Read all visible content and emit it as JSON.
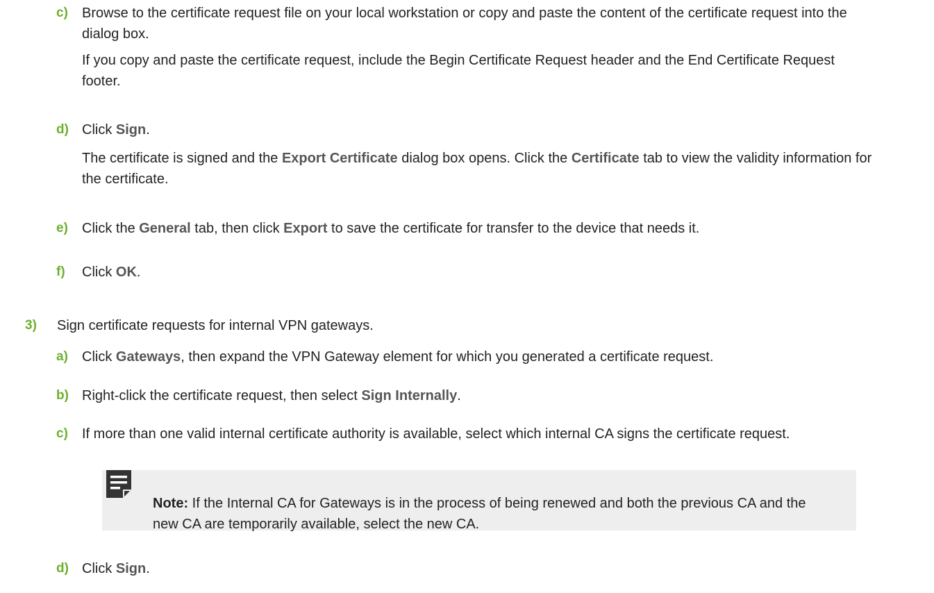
{
  "steps": {
    "c1": {
      "marker": "c)",
      "p1": "Browse to the certificate request file on your local workstation or copy and paste the content of the certificate request into the dialog box.",
      "p2": "If you copy and paste the certificate request, include the Begin Certificate Request header and the End Certificate Request footer."
    },
    "d1": {
      "marker": "d)",
      "prefix": "Click ",
      "ui": "Sign",
      "suffix": ".",
      "p2_a": "The certificate is signed and the ",
      "p2_ui1": "Export Certificate",
      "p2_b": " dialog box opens. Click the ",
      "p2_ui2": "Certificate",
      "p2_c": " tab to view the validity information for the certificate."
    },
    "e1": {
      "marker": "e)",
      "a": "Click the ",
      "ui1": "General",
      "b": " tab, then click ",
      "ui2": "Export",
      "c": " to save the certificate for transfer to the device that needs it."
    },
    "f1": {
      "marker": "f)",
      "prefix": "Click ",
      "ui": "OK",
      "suffix": "."
    },
    "s3": {
      "marker": "3)",
      "text": "Sign certificate requests for internal VPN gateways."
    },
    "a2": {
      "marker": "a)",
      "prefix": "Click ",
      "ui": "Gateways",
      "suffix": ", then expand the VPN Gateway element for which you generated a certificate request."
    },
    "b2": {
      "marker": "b)",
      "prefix": "Right-click the certificate request, then select ",
      "ui": "Sign Internally",
      "suffix": "."
    },
    "c2": {
      "marker": "c)",
      "text": "If more than one valid internal certificate authority is available, select which internal CA signs the certificate request."
    },
    "note": {
      "label": "Note:",
      "text": "  If the Internal CA for Gateways is in the process of being renewed and both the previous CA and the new CA are temporarily available, select the new CA.",
      "icon": "note-icon"
    },
    "d2": {
      "marker": "d)",
      "prefix": "Click ",
      "ui": "Sign",
      "suffix": "."
    }
  },
  "colors": {
    "marker": "#6bb02c",
    "ui_text": "#555555",
    "body_text": "#222222",
    "note_bg": "#eeeeee",
    "note_icon": "#333333"
  }
}
